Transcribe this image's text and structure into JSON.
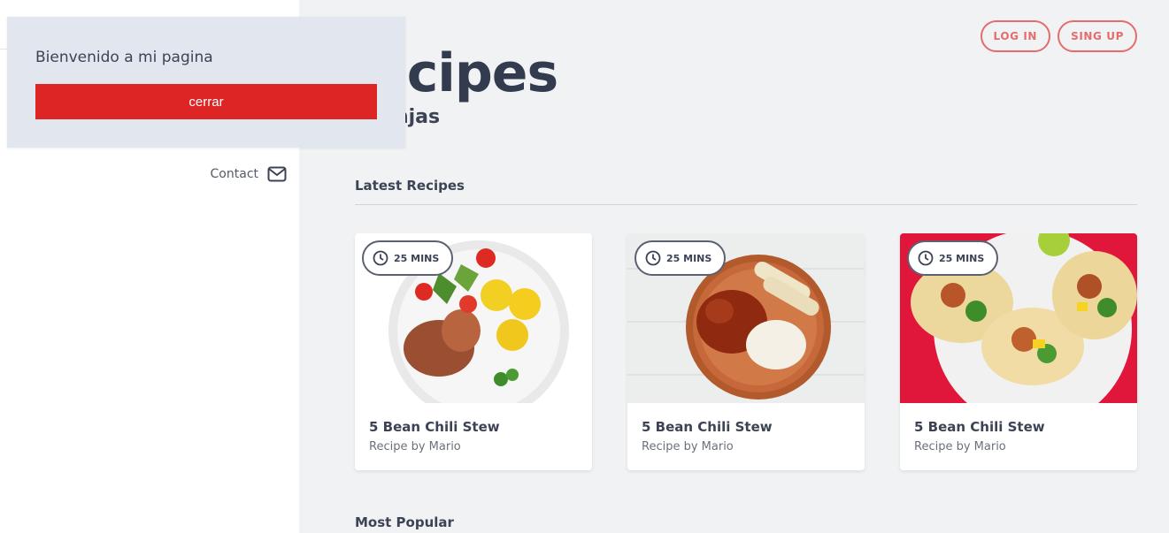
{
  "sidebar": {
    "contact_label": "Contact"
  },
  "header": {
    "login_label": "LOG IN",
    "signup_label": "SING UP"
  },
  "hero": {
    "title": "ecipes",
    "subtitle": "Ninjas"
  },
  "sections": {
    "latest": "Latest Recipes",
    "popular": "Most Popular"
  },
  "cards": [
    {
      "time": "25 MINS",
      "name": "5 Bean Chili Stew",
      "author": "Recipe by Mario",
      "photo_bg": "#ffffff"
    },
    {
      "time": "25 MINS",
      "name": "5 Bean Chili Stew",
      "author": "Recipe by Mario",
      "photo_bg": "#eceeed"
    },
    {
      "time": "25 MINS",
      "name": "5 Bean Chili Stew",
      "author": "Recipe by Mario",
      "photo_bg": "#e0173b"
    }
  ],
  "modal": {
    "message": "Bienvenido a mi pagina",
    "close_label": "cerrar"
  },
  "icons": {
    "contact": "mail-icon",
    "badge": "clock-icon"
  },
  "colors": {
    "accent": "#e46c6c",
    "close_button": "#dd2526",
    "modal_bg": "#e2e7ef",
    "page_bg": "#f1f2f4"
  }
}
